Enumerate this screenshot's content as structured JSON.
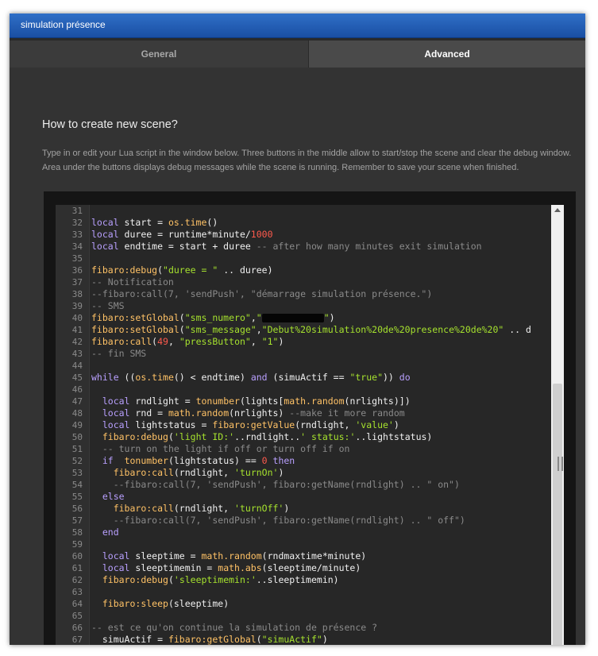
{
  "window": {
    "title": "simulation présence"
  },
  "tabs": [
    {
      "label": "General",
      "active": false
    },
    {
      "label": "Advanced",
      "active": true
    }
  ],
  "main": {
    "heading": "How to create new scene?",
    "description": "Type in or edit your Lua script in the window below. Three buttons in the middle allow to start/stop the scene and clear the debug window. Area under the buttons displays debug messages while the scene is running. Remember to save your scene when finished."
  },
  "colors": {
    "titlebar": "#1f5bb0",
    "background": "#333333",
    "keyword": "#b9a0ff",
    "function": "#ffc266",
    "string": "#a6e22e",
    "number": "#ff5a4d",
    "comment": "#8a8a8a"
  },
  "code": {
    "lines": [
      {
        "n": "31",
        "t": []
      },
      {
        "n": "32",
        "t": [
          [
            "kw",
            "local"
          ],
          [
            "op",
            " start = "
          ],
          [
            "fn",
            "os.time"
          ],
          [
            "op",
            "()"
          ]
        ]
      },
      {
        "n": "33",
        "t": [
          [
            "kw",
            "local"
          ],
          [
            "op",
            " duree = runtime*minute/"
          ],
          [
            "num",
            "1000"
          ]
        ]
      },
      {
        "n": "34",
        "t": [
          [
            "kw",
            "local"
          ],
          [
            "op",
            " endtime = start + duree "
          ],
          [
            "cm",
            "-- after how many minutes exit simulation"
          ]
        ]
      },
      {
        "n": "35",
        "t": []
      },
      {
        "n": "36",
        "t": [
          [
            "fn",
            "fibaro:debug"
          ],
          [
            "op",
            "("
          ],
          [
            "str",
            "\"duree = \""
          ],
          [
            "op",
            " .. duree)"
          ]
        ]
      },
      {
        "n": "37",
        "t": [
          [
            "cm",
            "-- Notification"
          ]
        ]
      },
      {
        "n": "38",
        "t": [
          [
            "cm",
            "--fibaro:call(7, 'sendPush', \"démarrage simulation présence.\")"
          ]
        ]
      },
      {
        "n": "39",
        "t": [
          [
            "cm",
            "-- SMS"
          ]
        ]
      },
      {
        "n": "40",
        "t": [
          [
            "fn",
            "fibaro:setGlobal"
          ],
          [
            "op",
            "("
          ],
          [
            "str",
            "\"sms_numero\""
          ],
          [
            "op",
            ","
          ],
          [
            "str",
            "\""
          ],
          [
            "redact",
            ""
          ],
          [
            "str",
            "\""
          ],
          [
            "op",
            ")"
          ]
        ]
      },
      {
        "n": "41",
        "t": [
          [
            "fn",
            "fibaro:setGlobal"
          ],
          [
            "op",
            "("
          ],
          [
            "str",
            "\"sms_message\""
          ],
          [
            "op",
            ","
          ],
          [
            "str",
            "\"Debut%20simulation%20de%20presence%20de%20\""
          ],
          [
            "op",
            " .. d"
          ]
        ]
      },
      {
        "n": "42",
        "t": [
          [
            "fn",
            "fibaro:call"
          ],
          [
            "op",
            "("
          ],
          [
            "num",
            "49"
          ],
          [
            "op",
            ", "
          ],
          [
            "str",
            "\"pressButton\""
          ],
          [
            "op",
            ", "
          ],
          [
            "str",
            "\"1\""
          ],
          [
            "op",
            ")"
          ]
        ]
      },
      {
        "n": "43",
        "t": [
          [
            "cm",
            "-- fin SMS"
          ]
        ]
      },
      {
        "n": "44",
        "t": []
      },
      {
        "n": "45",
        "t": [
          [
            "kw",
            "while"
          ],
          [
            "op",
            " (("
          ],
          [
            "fn",
            "os.time"
          ],
          [
            "op",
            "() < endtime) "
          ],
          [
            "kw",
            "and"
          ],
          [
            "op",
            " (simuActif == "
          ],
          [
            "str",
            "\"true\""
          ],
          [
            "op",
            "))"
          ],
          [
            "kw",
            " do"
          ]
        ]
      },
      {
        "n": "46",
        "t": []
      },
      {
        "n": "47",
        "t": [
          [
            "op",
            "  "
          ],
          [
            "kw",
            "local"
          ],
          [
            "op",
            " rndlight = "
          ],
          [
            "fn",
            "tonumber"
          ],
          [
            "op",
            "(lights["
          ],
          [
            "fn",
            "math.random"
          ],
          [
            "op",
            "(nrlights)])"
          ]
        ]
      },
      {
        "n": "48",
        "t": [
          [
            "op",
            "  "
          ],
          [
            "kw",
            "local"
          ],
          [
            "op",
            " rnd = "
          ],
          [
            "fn",
            "math.random"
          ],
          [
            "op",
            "(nrlights) "
          ],
          [
            "cm",
            "--make it more random"
          ]
        ]
      },
      {
        "n": "49",
        "t": [
          [
            "op",
            "  "
          ],
          [
            "kw",
            "local"
          ],
          [
            "op",
            " lightstatus = "
          ],
          [
            "fn",
            "fibaro:getValue"
          ],
          [
            "op",
            "(rndlight, "
          ],
          [
            "str",
            "'value'"
          ],
          [
            "op",
            ")"
          ]
        ]
      },
      {
        "n": "50",
        "t": [
          [
            "op",
            "  "
          ],
          [
            "fn",
            "fibaro:debug"
          ],
          [
            "op",
            "("
          ],
          [
            "str",
            "'light ID:'"
          ],
          [
            "op",
            "..rndlight.."
          ],
          [
            "str",
            "' status:'"
          ],
          [
            "op",
            "..lightstatus)"
          ]
        ]
      },
      {
        "n": "51",
        "t": [
          [
            "op",
            "  "
          ],
          [
            "cm",
            "-- turn on the light if off or turn off if on"
          ]
        ]
      },
      {
        "n": "52",
        "t": [
          [
            "op",
            "  "
          ],
          [
            "kw",
            "if"
          ],
          [
            "op",
            "  "
          ],
          [
            "fn",
            "tonumber"
          ],
          [
            "op",
            "(lightstatus) == "
          ],
          [
            "num",
            "0"
          ],
          [
            "kw",
            " then"
          ]
        ]
      },
      {
        "n": "53",
        "t": [
          [
            "op",
            "    "
          ],
          [
            "fn",
            "fibaro:call"
          ],
          [
            "op",
            "(rndlight, "
          ],
          [
            "str",
            "'turnOn'"
          ],
          [
            "op",
            ")"
          ]
        ]
      },
      {
        "n": "54",
        "t": [
          [
            "op",
            "    "
          ],
          [
            "cm",
            "--fibaro:call(7, 'sendPush', fibaro:getName(rndlight) .. \" on\")"
          ]
        ]
      },
      {
        "n": "55",
        "t": [
          [
            "op",
            "  "
          ],
          [
            "kw",
            "else"
          ]
        ]
      },
      {
        "n": "56",
        "t": [
          [
            "op",
            "    "
          ],
          [
            "fn",
            "fibaro:call"
          ],
          [
            "op",
            "(rndlight, "
          ],
          [
            "str",
            "'turnOff'"
          ],
          [
            "op",
            ")"
          ]
        ]
      },
      {
        "n": "57",
        "t": [
          [
            "op",
            "    "
          ],
          [
            "cm",
            "--fibaro:call(7, 'sendPush', fibaro:getName(rndlight) .. \" off\")"
          ]
        ]
      },
      {
        "n": "58",
        "t": [
          [
            "op",
            "  "
          ],
          [
            "kw",
            "end"
          ]
        ]
      },
      {
        "n": "59",
        "t": []
      },
      {
        "n": "60",
        "t": [
          [
            "op",
            "  "
          ],
          [
            "kw",
            "local"
          ],
          [
            "op",
            " sleeptime = "
          ],
          [
            "fn",
            "math.random"
          ],
          [
            "op",
            "(rndmaxtime*minute)"
          ]
        ]
      },
      {
        "n": "61",
        "t": [
          [
            "op",
            "  "
          ],
          [
            "kw",
            "local"
          ],
          [
            "op",
            " sleeptimemin = "
          ],
          [
            "fn",
            "math.abs"
          ],
          [
            "op",
            "(sleeptime/minute)"
          ]
        ]
      },
      {
        "n": "62",
        "t": [
          [
            "op",
            "  "
          ],
          [
            "fn",
            "fibaro:debug"
          ],
          [
            "op",
            "("
          ],
          [
            "str",
            "'sleeptimemin:'"
          ],
          [
            "op",
            "..sleeptimemin)"
          ]
        ]
      },
      {
        "n": "63",
        "t": []
      },
      {
        "n": "64",
        "t": [
          [
            "op",
            "  "
          ],
          [
            "fn",
            "fibaro:sleep"
          ],
          [
            "op",
            "(sleeptime)"
          ]
        ]
      },
      {
        "n": "65",
        "t": []
      },
      {
        "n": "66",
        "t": [
          [
            "cm",
            "-- est ce qu'on continue la simulation de présence ?"
          ]
        ]
      },
      {
        "n": "67",
        "t": [
          [
            "op",
            "  simuActif = "
          ],
          [
            "fn",
            "fibaro:getGlobal"
          ],
          [
            "op",
            "("
          ],
          [
            "str",
            "\"simuActif\""
          ],
          [
            "op",
            ")"
          ]
        ]
      }
    ]
  }
}
